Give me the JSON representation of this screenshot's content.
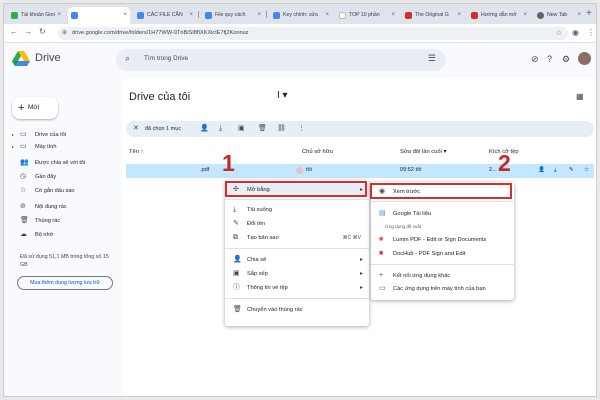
{
  "browser": {
    "tabs": [
      {
        "label": "Tài khoản Goo",
        "color": "#34a853"
      },
      {
        "label": "",
        "color": "#4285f4"
      },
      {
        "label": "CÁC FILE CẦN",
        "color": "#4285f4"
      },
      {
        "label": "File quy cách",
        "color": "#4285f4"
      },
      {
        "label": "Key chính: sửa",
        "color": "#4285f4"
      },
      {
        "label": "TOP 10 phần",
        "color": "#ffffff"
      },
      {
        "label": "The Original G",
        "color": "#d32f2f"
      },
      {
        "label": "Hướng dẫn mở",
        "color": "#d32f2f"
      },
      {
        "label": "New Tab",
        "color": "#5f6368"
      }
    ],
    "url": "drive.google.com/drive/folders/1H77WW-9TnBiSI8fIXKXlctE7fj2Konnuz"
  },
  "header": {
    "app_name": "Drive",
    "search_placeholder": "Tìm trong Drive"
  },
  "sidebar": {
    "new_label": "Mới",
    "items": [
      {
        "label": "Drive của tôi",
        "icon": "drive-icon"
      },
      {
        "label": "Máy tính",
        "icon": "computer-icon"
      },
      {
        "label": "Được chia sẻ với tôi",
        "icon": "shared-icon"
      },
      {
        "label": "Gần đây",
        "icon": "clock-icon"
      },
      {
        "label": "Có gắn dấu sao",
        "icon": "star-icon"
      },
      {
        "label": "Nội dung rác",
        "icon": "spam-icon"
      },
      {
        "label": "Thùng rác",
        "icon": "trash-icon"
      },
      {
        "label": "Bộ nhớ",
        "icon": "cloud-icon"
      }
    ],
    "storage_text": "Đã sử dụng 51,1 MB trong tổng số 15 GB",
    "buy_label": "Mua thêm dung lượng lưu trữ"
  },
  "main": {
    "title": "Drive của tôi",
    "cursor_glyph": "I",
    "selection": "đã chọn 1 mục",
    "columns": {
      "name": "Tên",
      "owner": "Chủ sở hữu",
      "modified": "Sửa đổi lần cuối",
      "size": "Kích cỡ tệp"
    },
    "row": {
      "name": ".pdf",
      "owner": "tôi",
      "modified": "09:52 tôi",
      "size": "2..."
    }
  },
  "context_menu": {
    "items": [
      {
        "label": "Mở bằng",
        "icon": "open-with-icon"
      },
      {
        "label": "Tải xuống",
        "icon": "download-icon"
      },
      {
        "label": "Đổi tên",
        "icon": "rename-icon"
      },
      {
        "label": "Tạo bản sao",
        "icon": "copy-icon",
        "shortcut": "⌘C ⌘V"
      },
      {
        "label": "Chia sẻ",
        "icon": "share-icon"
      },
      {
        "label": "Sắp xếp",
        "icon": "organize-icon"
      },
      {
        "label": "Thông tin về tệp",
        "icon": "info-icon"
      },
      {
        "label": "Chuyển vào thùng rác",
        "icon": "trash-icon"
      }
    ]
  },
  "submenu": {
    "items": [
      {
        "label": "Xem trước",
        "icon": "eye-icon"
      },
      {
        "label": "Google Tài liệu",
        "icon": "docs-icon"
      },
      {
        "label": "Lumin PDF - Edit or Sign Documents",
        "icon": "lumin-icon"
      },
      {
        "label": "DocHub - PDF Sign and Edit",
        "icon": "dochub-icon"
      },
      {
        "label": "Kết nối ứng dụng khác",
        "icon": "plus-icon"
      },
      {
        "label": "Các ứng dụng trên máy tính của bạn",
        "icon": "desktop-icon"
      }
    ],
    "suggested_label": "Ứng dụng đề xuất"
  },
  "annotations": {
    "step1": "1",
    "step2": "2"
  }
}
